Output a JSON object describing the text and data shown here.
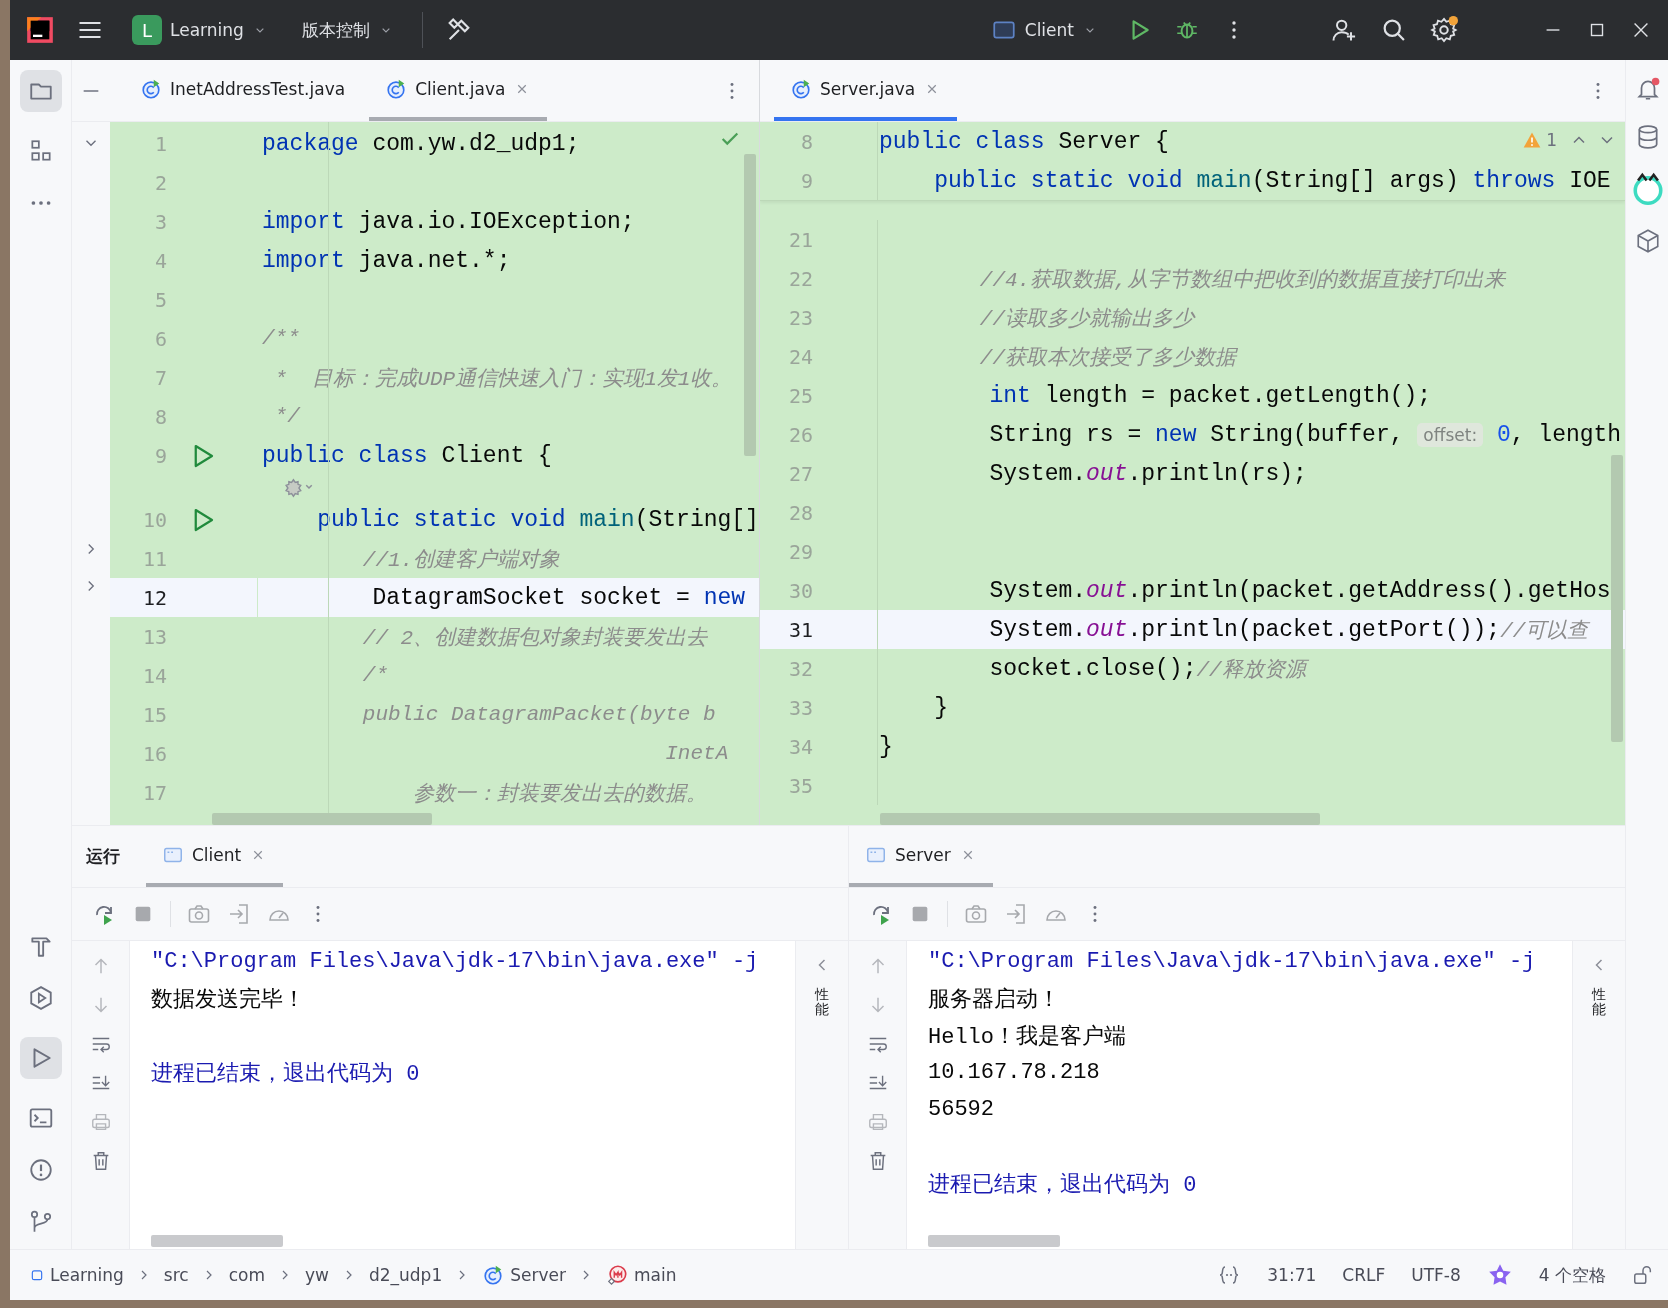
{
  "title_bar": {
    "project_initial": "L",
    "project": "Learning",
    "vcs_menu": "版本控制",
    "run_config": "Client",
    "settings_badge": true
  },
  "left_editor": {
    "focused": false,
    "tabs": [
      {
        "label": "InetAddressTest.java",
        "selected": false,
        "closable": false
      },
      {
        "label": "Client.java",
        "selected": true,
        "closable": true
      }
    ],
    "lines": [
      {
        "kind": "code",
        "number": "1",
        "current": false,
        "run": false,
        "tokens": [
          {
            "kind": "kw",
            "text": "package"
          },
          {
            "kind": "text",
            "text": " com.yw.d2_udp1;"
          }
        ]
      },
      {
        "kind": "code",
        "number": "2",
        "current": false,
        "run": false
      },
      {
        "kind": "code",
        "number": "3",
        "current": false,
        "run": false,
        "tokens": [
          {
            "kind": "kw",
            "text": "import"
          },
          {
            "kind": "text",
            "text": " java.io.IOException;"
          }
        ]
      },
      {
        "kind": "code",
        "number": "4",
        "current": false,
        "run": false,
        "tokens": [
          {
            "kind": "kw",
            "text": "import"
          },
          {
            "kind": "text",
            "text": " java.net.*;"
          }
        ]
      },
      {
        "kind": "code",
        "number": "5",
        "current": false,
        "run": false
      },
      {
        "kind": "code",
        "number": "6",
        "current": false,
        "run": false,
        "tokens": [
          {
            "kind": "comment",
            "text": "/**"
          }
        ]
      },
      {
        "kind": "code",
        "number": "7",
        "current": false,
        "run": false,
        "tokens": [
          {
            "kind": "comment",
            "text": " *  目标：完成UDP通信快速入门：实现1发1收。"
          }
        ]
      },
      {
        "kind": "code",
        "number": "8",
        "current": false,
        "run": false,
        "tokens": [
          {
            "kind": "comment",
            "text": " */"
          }
        ]
      },
      {
        "kind": "code",
        "number": "9",
        "current": false,
        "run": true,
        "tokens": [
          {
            "kind": "kw",
            "text": "public class"
          },
          {
            "kind": "text",
            "text": " Client {"
          }
        ]
      },
      {
        "kind": "inlay"
      },
      {
        "kind": "code",
        "number": "10",
        "current": false,
        "run": true,
        "tokens": [
          {
            "kind": "kw",
            "text": "    public static void"
          },
          {
            "kind": "fn",
            "text": " main"
          },
          {
            "kind": "text",
            "text": "(String[]"
          }
        ]
      },
      {
        "kind": "code",
        "number": "11",
        "current": false,
        "run": false,
        "tokens": [
          {
            "kind": "comment",
            "text": "        //1.创建客户端对象"
          }
        ]
      },
      {
        "kind": "code",
        "number": "12",
        "current": true,
        "run": false,
        "tokens": [
          {
            "kind": "text",
            "text": "        DatagramSocket socket = "
          },
          {
            "kind": "kw",
            "text": "new"
          }
        ]
      },
      {
        "kind": "code",
        "number": "13",
        "current": false,
        "run": false,
        "tokens": [
          {
            "kind": "comment",
            "text": "        // 2、创建数据包对象封装要发出去"
          }
        ]
      },
      {
        "kind": "code",
        "number": "14",
        "current": false,
        "run": false,
        "tokens": [
          {
            "kind": "comment",
            "text": "        /*"
          }
        ]
      },
      {
        "kind": "code",
        "number": "15",
        "current": false,
        "run": false,
        "tokens": [
          {
            "kind": "comment",
            "text": "        public DatagramPacket(byte b"
          }
        ]
      },
      {
        "kind": "code",
        "number": "16",
        "current": false,
        "run": false,
        "tokens": [
          {
            "kind": "comment",
            "text": "                                InetA"
          }
        ]
      },
      {
        "kind": "code",
        "number": "17",
        "current": false,
        "run": false,
        "tokens": [
          {
            "kind": "comment",
            "text": "            参数一：封装要发出去的数据。"
          }
        ]
      }
    ]
  },
  "right_editor": {
    "focused": true,
    "warnings": "1",
    "tabs": [
      {
        "label": "Server.java",
        "selected": true,
        "closable": true
      }
    ],
    "sticky_lines": [
      {
        "number": "8",
        "tokens": [
          {
            "kind": "kw",
            "text": "public class"
          },
          {
            "kind": "text",
            "text": " Server {"
          }
        ]
      },
      {
        "number": "9",
        "tokens": [
          {
            "kind": "kw",
            "text": "    public static void"
          },
          {
            "kind": "fn",
            "text": " main"
          },
          {
            "kind": "text",
            "text": "(String[] args) "
          },
          {
            "kind": "kw",
            "text": "throws"
          },
          {
            "kind": "text",
            "text": " IOE"
          }
        ]
      }
    ],
    "lines": [
      {
        "kind": "code",
        "number": "21",
        "current": false
      },
      {
        "kind": "code",
        "number": "22",
        "current": false,
        "tokens": [
          {
            "kind": "comment",
            "text": "        //4.获取数据,从字节数组中把收到的数据直接打印出来"
          }
        ]
      },
      {
        "kind": "code",
        "number": "23",
        "current": false,
        "tokens": [
          {
            "kind": "comment",
            "text": "        //读取多少就输出多少"
          }
        ]
      },
      {
        "kind": "code",
        "number": "24",
        "current": false,
        "tokens": [
          {
            "kind": "comment",
            "text": "        //获取本次接受了多少数据"
          }
        ]
      },
      {
        "kind": "code",
        "number": "25",
        "current": false,
        "tokens": [
          {
            "kind": "kw",
            "text": "        int"
          },
          {
            "kind": "text",
            "text": " length = packet.getLength();"
          }
        ]
      },
      {
        "kind": "code",
        "number": "26",
        "current": false,
        "tokens": [
          {
            "kind": "text",
            "text": "        String rs = "
          },
          {
            "kind": "kw",
            "text": "new"
          },
          {
            "kind": "text",
            "text": " String(buffer, "
          },
          {
            "kind": "hint",
            "text": "offset:"
          },
          {
            "kind": "num",
            "text": " 0"
          },
          {
            "kind": "text",
            "text": ", length"
          }
        ]
      },
      {
        "kind": "code",
        "number": "27",
        "current": false,
        "tokens": [
          {
            "kind": "text",
            "text": "        System."
          },
          {
            "kind": "field",
            "text": "out"
          },
          {
            "kind": "text",
            "text": ".println(rs);"
          }
        ]
      },
      {
        "kind": "code",
        "number": "28",
        "current": false
      },
      {
        "kind": "code",
        "number": "29",
        "current": false
      },
      {
        "kind": "code",
        "number": "30",
        "current": false,
        "tokens": [
          {
            "kind": "text",
            "text": "        System."
          },
          {
            "kind": "field",
            "text": "out"
          },
          {
            "kind": "text",
            "text": ".println(packet.getAddress().getHos"
          }
        ]
      },
      {
        "kind": "code",
        "number": "31",
        "current": true,
        "tokens": [
          {
            "kind": "text",
            "text": "        System."
          },
          {
            "kind": "field",
            "text": "out"
          },
          {
            "kind": "text",
            "text": ".println(packet.getPort());"
          },
          {
            "kind": "comment",
            "text": "//可以查"
          }
        ]
      },
      {
        "kind": "code",
        "number": "32",
        "current": false,
        "tokens": [
          {
            "kind": "text",
            "text": "        socket.close();"
          },
          {
            "kind": "comment",
            "text": "//释放资源"
          }
        ]
      },
      {
        "kind": "code",
        "number": "33",
        "current": false,
        "tokens": [
          {
            "kind": "text",
            "text": "    }"
          }
        ]
      },
      {
        "kind": "code",
        "number": "34",
        "current": false,
        "tokens": [
          {
            "kind": "text",
            "text": "}"
          }
        ]
      },
      {
        "kind": "code",
        "number": "35",
        "current": false
      }
    ]
  },
  "run_panels": [
    {
      "title": "运行",
      "side_label": "性能",
      "tabs": [
        {
          "label": "Client",
          "selected": true,
          "closable": true
        }
      ],
      "console": [
        {
          "kind": "command",
          "text": "\"C:\\Program Files\\Java\\jdk-17\\bin\\java.exe\" -j"
        },
        {
          "kind": "output",
          "text": "数据发送完毕！"
        },
        {
          "kind": "blank"
        },
        {
          "kind": "exit",
          "text": "进程已结束，退出代码为 0"
        }
      ]
    },
    {
      "side_label": "性能",
      "tabs": [
        {
          "label": "Server",
          "selected": true,
          "closable": true
        }
      ],
      "console": [
        {
          "kind": "command",
          "text": "\"C:\\Program Files\\Java\\jdk-17\\bin\\java.exe\" -j"
        },
        {
          "kind": "output",
          "text": "服务器启动！"
        },
        {
          "kind": "output",
          "text": "Hello！我是客户端"
        },
        {
          "kind": "output",
          "text": "10.167.78.218"
        },
        {
          "kind": "output",
          "text": "56592"
        },
        {
          "kind": "blank"
        },
        {
          "kind": "exit",
          "text": "进程已结束，退出代码为 0"
        }
      ]
    }
  ],
  "status_bar": {
    "breadcrumbs": [
      {
        "label": "Learning",
        "kind": "module"
      },
      {
        "label": "src",
        "kind": "folder"
      },
      {
        "label": "com",
        "kind": "folder"
      },
      {
        "label": "yw",
        "kind": "folder"
      },
      {
        "label": "d2_udp1",
        "kind": "folder"
      },
      {
        "label": "Server",
        "kind": "class"
      },
      {
        "label": "main",
        "kind": "method"
      }
    ],
    "caret_position": "31:71",
    "line_separator": "CRLF",
    "encoding": "UTF-8",
    "indent": "4 个空格"
  }
}
